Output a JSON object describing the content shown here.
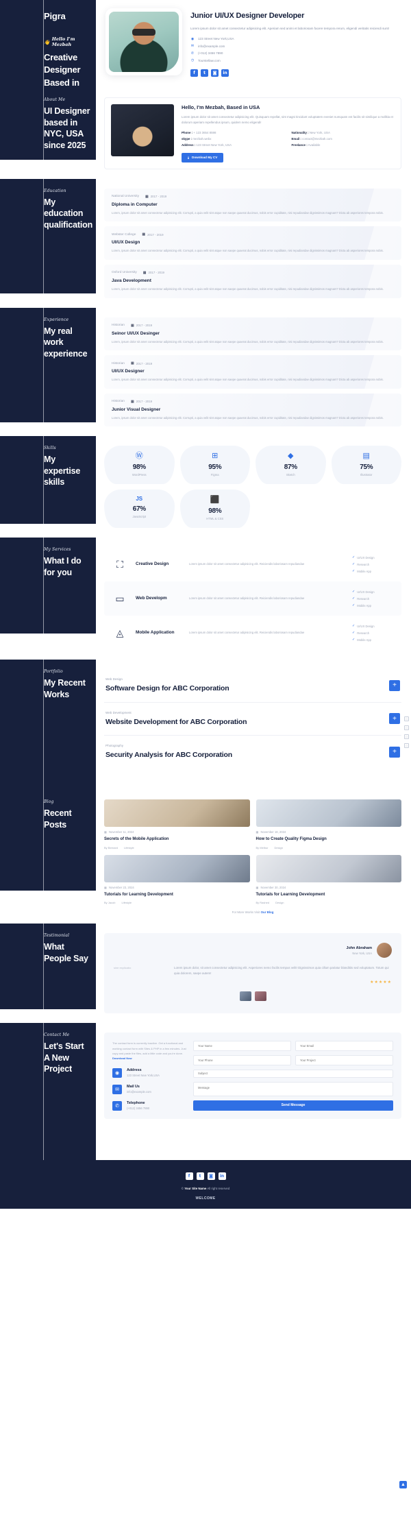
{
  "brand": "Pigra",
  "hero": {
    "greeting": "Hello I'm Mezbah",
    "wave": "👋",
    "heading": "Creative Designer Based in USA",
    "name": "Junior UI/UX Designer Developer",
    "description": "Lorem ipsum dolor sit amet consectetur adipisicing elit. Aperiam sed animi et laboriosam facere tempora rerum, eligendi veritatis reiciendi sunt!",
    "contacts": [
      {
        "icon": "location-icon",
        "glyph": "◉",
        "text": "123 Street New York,USA"
      },
      {
        "icon": "mail-icon",
        "glyph": "✉",
        "text": "info@example.com"
      },
      {
        "icon": "phone-icon",
        "glyph": "✆",
        "text": "(+012) 3456 7890"
      },
      {
        "icon": "clock-icon",
        "glyph": "◷",
        "text": "Tourstellaw.com"
      }
    ],
    "socials": [
      {
        "name": "facebook-icon",
        "glyph": "f"
      },
      {
        "name": "twitter-icon",
        "glyph": "t"
      },
      {
        "name": "instagram-icon",
        "glyph": "◙"
      },
      {
        "name": "linkedin-icon",
        "glyph": "in"
      }
    ]
  },
  "about": {
    "tag": "About Me",
    "title": "UI Designer based in NYC, USA since 2025",
    "heading": "Hello, I'm Mezbah, Based in USA",
    "paragraph": "Lorem ipsum dolor sit amet consectetur adipisicing elit. Quisquam repellat, sint magni tincidunt voluptatem eveniet numquam est facilis sit similique a mollitia et dolorum aperiam repellendus ipsum, quidem nemo eligendi!",
    "details": [
      {
        "label": "Phone :",
        "value": "+ 123 3654 8598"
      },
      {
        "label": "Nationality :",
        "value": "New York, USA"
      },
      {
        "label": "skype :",
        "value": "mezbah.webx"
      },
      {
        "label": "Email :",
        "value": "contact@mezbah.com"
      },
      {
        "label": "Address :",
        "value": "123 Street New York, USA"
      },
      {
        "label": "Freelance :",
        "value": "Available"
      }
    ],
    "cv_button": "Download My CV",
    "cv_icon": "download-icon"
  },
  "education": {
    "tag": "Education",
    "title": "My education qualification",
    "items": [
      {
        "institution": "National University",
        "date": "2017 - 2019",
        "title": "Diploma in Computer",
        "text": "Lorem, ipsum dolor sit amet consectetur adipisicing elit. Corrupti, a quia velit sint atque non saepe quaerat ducimus, nobis error cupiditate, nisi repudiandae dignissimos magnam? Dicta ab asperiores tempora nobis."
      },
      {
        "institution": "Webster College",
        "date": "2017 - 2019",
        "title": "UI/UX Design",
        "text": "Lorem, ipsum dolor sit amet consectetur adipisicing elit. Corrupti, a quia velit sint atque non saepe quaerat ducimus, nobis error cupiditate, nisi repudiandae dignissimos magnam? Dicta ab asperiores tempora nobis."
      },
      {
        "institution": "Oxford University",
        "date": "2017 - 2019",
        "title": "Java Development",
        "text": "Lorem, ipsum dolor sit amet consectetur adipisicing elit. Corrupti, a quia velit sint atque non saepe quaerat ducimus, nobis error cupiditate, nisi repudiandae dignissimos magnam? Dicta ab asperiores tempora nobis."
      }
    ]
  },
  "experience": {
    "tag": "Experience",
    "title": "My real work experience",
    "items": [
      {
        "institution": "Historian",
        "date": "2017 - 2019",
        "title": "Seinor UI/UX Desinger",
        "text": "Lorem, ipsum dolor sit amet consectetur adipisicing elit. Corrupti, a quia velit sint atque non saepe quaerat ducimus, nobis error cupiditate, nisi repudiandae dignissimos magnam? Dicta ab asperiores tempora nobis."
      },
      {
        "institution": "Historian",
        "date": "2017 - 2019",
        "title": "UI/UX Designer",
        "text": "Lorem, ipsum dolor sit amet consectetur adipisicing elit. Corrupti, a quia velit sint atque non saepe quaerat ducimus, nobis error cupiditate, nisi repudiandae dignissimos magnam? Dicta ab asperiores tempora nobis."
      },
      {
        "institution": "Historian",
        "date": "2017 - 2019",
        "title": "Junior Visual Designer",
        "text": "Lorem, ipsum dolor sit amet consectetur adipisicing elit. Corrupti, a quia velit sint atque non saepe quaerat ducimus, nobis error cupiditate, nisi repudiandae dignissimos magnam? Dicta ab asperiores tempora nobis."
      }
    ]
  },
  "skills": {
    "tag": "Skills",
    "title": "My expertise skills",
    "items": [
      {
        "icon": "wordpress-icon",
        "glyph": "Ⓦ",
        "color": "#2f6fe4",
        "value": "98%",
        "label": "WordPress"
      },
      {
        "icon": "figma-icon",
        "glyph": "⊞",
        "color": "#2f6fe4",
        "value": "95%",
        "label": "Figma"
      },
      {
        "icon": "sketch-icon",
        "glyph": "◆",
        "color": "#2f6fe4",
        "value": "87%",
        "label": "Sketch"
      },
      {
        "icon": "illustrator-icon",
        "glyph": "▤",
        "color": "#2f6fe4",
        "value": "75%",
        "label": "Illustrator"
      },
      {
        "icon": "javascript-icon",
        "glyph": "JS",
        "color": "#2f6fe4",
        "value": "67%",
        "label": "JavaScript"
      },
      {
        "icon": "html5-icon",
        "glyph": "⬛",
        "color": "#2f6fe4",
        "value": "98%",
        "label": "HTML & CSS"
      }
    ]
  },
  "services": {
    "tag": "My Services",
    "title": "What I do for you",
    "items": [
      {
        "icon": "network-icon",
        "glyph": "⛶",
        "name": "Creative Design",
        "desc": "Lorem ipsum dolor sit amet consectetur adipisicing elit. Reiciendis laboriosam repudiandae",
        "features": [
          "UI/UX Design",
          "Research",
          "Mobile App"
        ]
      },
      {
        "icon": "laptop-code-icon",
        "glyph": "▭",
        "name": "Web Developm",
        "desc": "Lorem ipsum dolor sit amet consectetur adipisicing elit. Reiciendis laboriosam repudiandae",
        "features": [
          "UI/UX Design",
          "Research",
          "Mobile App"
        ]
      },
      {
        "icon": "app-store-icon",
        "glyph": "◬",
        "name": "Mobile Application",
        "desc": "Lorem ipsum dolor sit amet consectetur adipisicing elit. Reiciendis laboriosam repudiandae",
        "features": [
          "UI/UX Design",
          "Research",
          "Mobile App"
        ]
      }
    ]
  },
  "portfolio": {
    "tag": "Portfolio",
    "title": "My Recent Works",
    "items": [
      {
        "category": "Web Design",
        "title": "Software Design for ABC Corporation",
        "button": "+"
      },
      {
        "category": "Web Development",
        "title": "Website Development for ABC Corporation",
        "button": "+"
      },
      {
        "category": "Photography",
        "title": "Security Analysis for ABC Corporation",
        "button": "+"
      }
    ]
  },
  "blog": {
    "tag": "Blog",
    "title": "Recent Posts",
    "posts": [
      {
        "date": "November 11, 2024",
        "title": "Secrets of the Mobile Application",
        "author": "By Bernard",
        "category": "Lifestyle"
      },
      {
        "date": "November 18, 2024",
        "title": "How to Create Quality Figma Design",
        "author": "By Melbur",
        "category": "Design"
      },
      {
        "date": "November 23, 2024",
        "title": "Tutorials for Learning Development",
        "author": "By Jacob",
        "category": "Lifestyle"
      },
      {
        "date": "November 30, 2024",
        "title": "Tutorials for Learning Development",
        "author": "By Rashed",
        "category": "Design"
      }
    ],
    "more_text": "For More Works Visit",
    "more_link": "Our Blog"
  },
  "testimonial": {
    "tag": "Testimonial",
    "title": "What People Say",
    "name": "John Abraham",
    "location": "New York, USA",
    "quote_left": "sine explicabo",
    "text": "Lorem ipsum dolor, sit amet consectetur adipisicing elit. Asperiores nemo facilis tempus velit! Dignissimos quia cillum pariatur blanditiis sed voluptatum. Totum qui quia dolorem, saepe autem!",
    "stars": "★★★★★"
  },
  "contact": {
    "tag": "Contact Me",
    "title": "Let's Start A New Project",
    "note": "The contact form is currently inactive. Get a functional and working contact form with Sites & PHP in a few minutes. Just copy and paste the files, add a little code and you're done.",
    "note_link": "Download Now",
    "items": [
      {
        "icon": "location-icon",
        "glyph": "◉",
        "label": "Address",
        "value": "123 Street New York,USA"
      },
      {
        "icon": "mail-icon",
        "glyph": "✉",
        "label": "Mail Us",
        "value": "info@example.com"
      },
      {
        "icon": "phone-icon",
        "glyph": "✆",
        "label": "Telephone",
        "value": "(+012) 3456 7890"
      }
    ],
    "form": {
      "name_placeholder": "Your Name",
      "email_placeholder": "Your Email",
      "phone_placeholder": "Your Phone",
      "project_placeholder": "Your Project",
      "subject_placeholder": "Subject",
      "message_placeholder": "Message",
      "submit": "Send Message"
    }
  },
  "footer": {
    "socials": [
      {
        "name": "facebook-icon",
        "glyph": "f"
      },
      {
        "name": "twitter-icon",
        "glyph": "t"
      },
      {
        "name": "instagram-icon",
        "glyph": "◙"
      },
      {
        "name": "linkedin-icon",
        "glyph": "in"
      }
    ],
    "copyright_prefix": "©",
    "copyright_link": "Your Site Name",
    "copyright_suffix": "All right reserved",
    "logo": "WELCOME"
  },
  "sidedots": [
    "□",
    "□",
    "□",
    "□"
  ],
  "back_to_top": "▲"
}
